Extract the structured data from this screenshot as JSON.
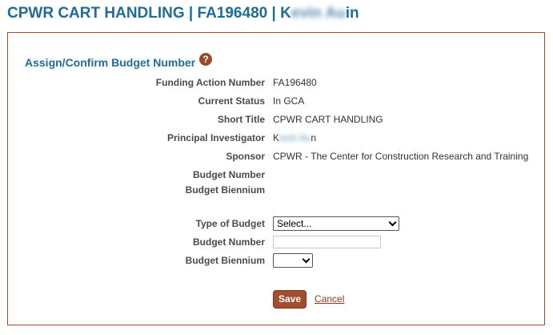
{
  "header": {
    "title_prefix": "CPWR CART HANDLING | FA196480 | K",
    "title_redacted": "evin Au",
    "title_suffix": "in"
  },
  "section": {
    "title": "Assign/Confirm Budget Number",
    "help": "?"
  },
  "details": [
    {
      "label": "Funding Action Number",
      "value": "FA196480"
    },
    {
      "label": "Current Status",
      "value": "In GCA"
    },
    {
      "label": "Short Title",
      "value": "CPWR CART HANDLING"
    },
    {
      "label": "Principal Investigator",
      "value_prefix": "K",
      "value_redacted": "evin Au",
      "value_suffix": "n"
    },
    {
      "label": "Sponsor",
      "value": "CPWR - The Center for Construction Research and Training"
    },
    {
      "label": "Budget Number",
      "value": ""
    },
    {
      "label": "Budget Biennium",
      "value": ""
    }
  ],
  "form": {
    "type_label": "Type of Budget",
    "type_selected": "Select...",
    "number_label": "Budget Number",
    "number_value": "",
    "biennium_label": "Budget Biennium",
    "biennium_selected": ""
  },
  "actions": {
    "save": "Save",
    "cancel": "Cancel"
  },
  "colors": {
    "title": "#1f6d94",
    "accent": "#a44c2e"
  }
}
